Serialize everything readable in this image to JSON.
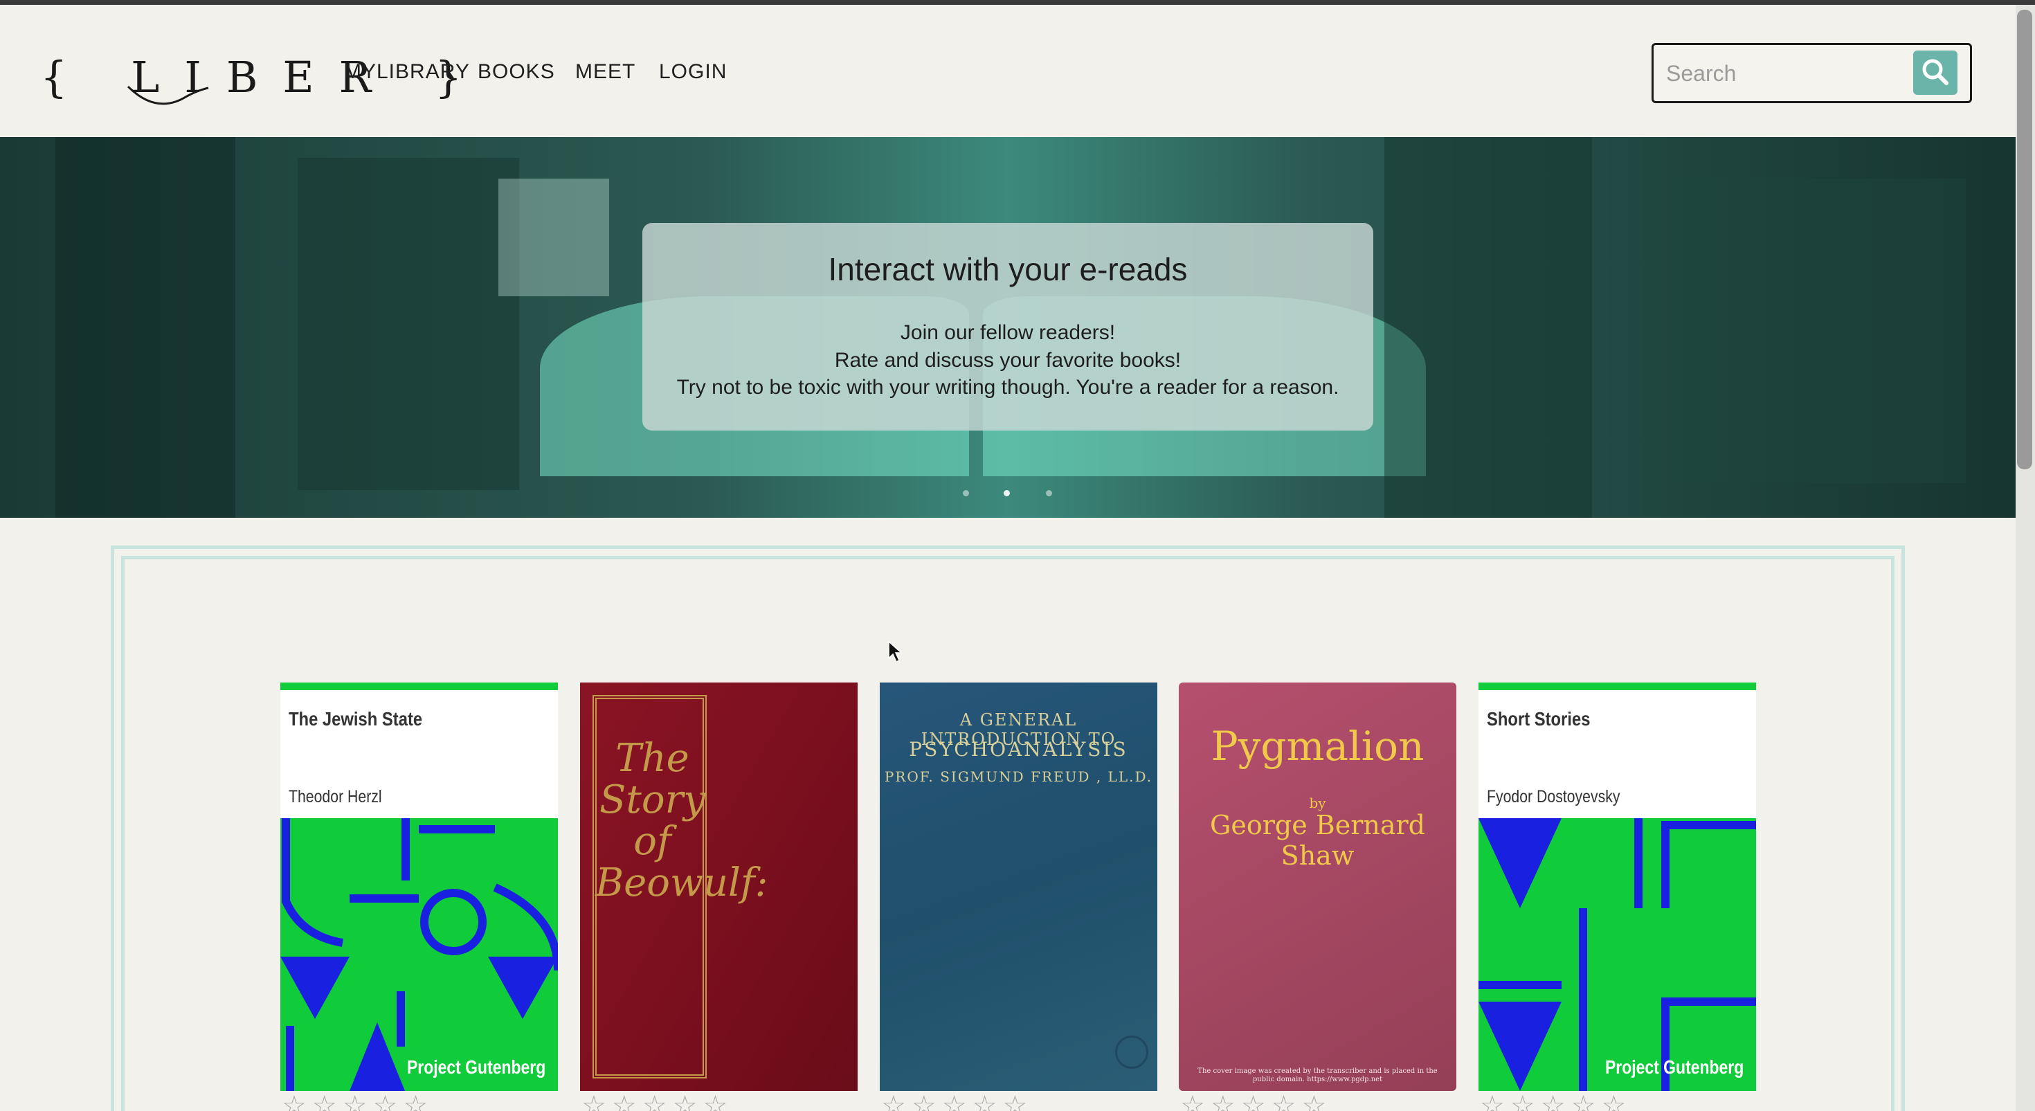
{
  "app": {
    "logo_text": "{ LIBER }"
  },
  "nav": {
    "mylibrary": "MYLIBRARY",
    "books": "BOOKS",
    "meet": "MEET",
    "login": "LOGIN"
  },
  "search": {
    "placeholder": "Search",
    "value": "",
    "icon": "search-icon"
  },
  "hero": {
    "title": "Interact with your e-reads",
    "lines": [
      "Join our fellow readers!",
      "Rate and discuss your favorite books!",
      "Try not to be toxic with your writing though. You're a reader for a reason."
    ],
    "slides": 3,
    "active_slide": 2
  },
  "books": [
    {
      "title": "The Jewish State",
      "author": "Theodor Herzl",
      "cover_brand": "Project Gutenberg",
      "rating": 0,
      "max_rating": 5
    },
    {
      "cover_text": "The Story of Beowulf:",
      "rating": 0,
      "max_rating": 5
    },
    {
      "cover_lines": [
        "A GENERAL INTRODUCTION TO",
        "PSYCHOANALYSIS",
        "PROF. SIGMUND FREUD , LL.D."
      ],
      "rating": 0,
      "max_rating": 5
    },
    {
      "cover_title": "Pygmalion",
      "cover_by": "by",
      "cover_author": "George Bernard Shaw",
      "cover_note": "The cover image was created by the transcriber and is placed in the public domain. https://www.pgdp.net",
      "rating": 0,
      "max_rating": 5
    },
    {
      "title": "Short Stories",
      "author": "Fyodor Dostoyevsky",
      "cover_brand": "Project Gutenberg",
      "rating": 0,
      "max_rating": 5
    }
  ],
  "star_glyphs": "☆☆☆☆☆",
  "colors": {
    "accent": "#6ab4aa",
    "gutenberg_green": "#10cc3a",
    "gutenberg_blue": "#1a20e0",
    "panel_border": "#c7e3de"
  }
}
